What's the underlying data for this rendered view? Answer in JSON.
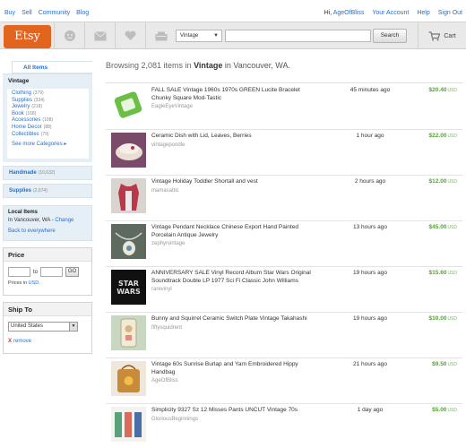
{
  "topnav": {
    "links": [
      "Buy",
      "Sell",
      "Community",
      "Blog"
    ],
    "greeting_prefix": "Hi,",
    "username": "AgeOfBliss",
    "account": "Your Account",
    "help": "Help",
    "signout": "Sign Out"
  },
  "header": {
    "logo": "Etsy",
    "search_scope": "Vintage",
    "search_value": "",
    "search_button": "Search",
    "cart": "Cart",
    "icons": [
      "smiley-icon",
      "mail-icon",
      "heart-icon",
      "register-icon"
    ]
  },
  "sidebar": {
    "tab_label": "All Items",
    "category_title": "Vintage",
    "categories": [
      {
        "label": "Clothing",
        "count": "(379)"
      },
      {
        "label": "Supplies",
        "count": "(334)"
      },
      {
        "label": "Jewelry",
        "count": "(218)"
      },
      {
        "label": "Book",
        "count": "(168)"
      },
      {
        "label": "Accessories",
        "count": "(108)"
      },
      {
        "label": "Home Decor",
        "count": "(88)"
      },
      {
        "label": "Collectibles",
        "count": "(79)"
      }
    ],
    "see_more": "See more Categories ▸",
    "handmade": {
      "label": "Handmade",
      "count": "(10,632)"
    },
    "supplies": {
      "label": "Supplies",
      "count": "(2,674)"
    },
    "local": {
      "title": "Local Items",
      "location": "In Vancouver, WA -",
      "change": "Change",
      "back": "Back to everywhere"
    },
    "price": {
      "title": "Price",
      "to": "to",
      "go": "GO",
      "note_prefix": "Prices in",
      "currency": "USD."
    },
    "ship": {
      "title": "Ship To",
      "selected": "United States",
      "remove_x": "X",
      "remove": "remove"
    }
  },
  "results": {
    "prefix": "Browsing 2,081 items in",
    "keyword": "Vintage",
    "suffix": "in Vancouver, WA."
  },
  "listings": [
    {
      "title": "FALL SALE Vintage 1960s 1970s GREEN Lucite Bracelet Chunky Square Mod-Tastic",
      "shop": "EagleEyeVintage",
      "time": "45 minutes ago",
      "price": "$20.40",
      "currency": "USD",
      "thumb_color": "#6bbf45",
      "thumb_type": "bracelet"
    },
    {
      "title": "Ceramic Dish with Lid, Leaves, Berries",
      "shop": "vintagepoodle",
      "time": "1 hour ago",
      "price": "$22.00",
      "currency": "USD",
      "thumb_color": "#7a4a6a",
      "thumb_type": "dish"
    },
    {
      "title": "Vintage Holiday Toddler Shortall and vest",
      "shop": "mamasattic",
      "time": "2 hours ago",
      "price": "$12.00",
      "currency": "USD",
      "thumb_color": "#b8394a",
      "thumb_type": "vest"
    },
    {
      "title": "Vintage Pendant Necklace Chinese Export Hand Painted Porcelain Antique Jewelry",
      "shop": "zephyrvintage",
      "time": "13 hours ago",
      "price": "$45.00",
      "currency": "USD",
      "thumb_color": "#5d6a5d",
      "thumb_type": "pendant"
    },
    {
      "title": "ANNIVERSARY SALE Vinyl Record Album Star Wars Original Soundtrack Double LP 1977 Sci Fi Classic John Williams",
      "shop": "rarevinyl",
      "time": "19 hours ago",
      "price": "$15.60",
      "currency": "USD",
      "thumb_color": "#111111",
      "thumb_type": "starwars"
    },
    {
      "title": "Bunny and Squirrel Ceramic Switch Plate Vintage Takahashi",
      "shop": "fiftysquidrent",
      "time": "19 hours ago",
      "price": "$10.00",
      "currency": "USD",
      "thumb_color": "#c7d7c2",
      "thumb_type": "plate"
    },
    {
      "title": "Vintage 60s Sunrise Burlap and Yarn Embroidered Hippy Handbag",
      "shop": "AgeOfBliss",
      "time": "21 hours ago",
      "price": "$9.50",
      "currency": "USD",
      "thumb_color": "#c98a3a",
      "thumb_type": "bag"
    },
    {
      "title": "Simplicity 9327 Sz 12 Misses Pants UNCUT Vintage 70s",
      "shop": "GloriousBeginnings",
      "time": "1 day ago",
      "price": "$5.00",
      "currency": "USD",
      "thumb_color": "#5aa07a",
      "thumb_type": "pattern"
    }
  ]
}
